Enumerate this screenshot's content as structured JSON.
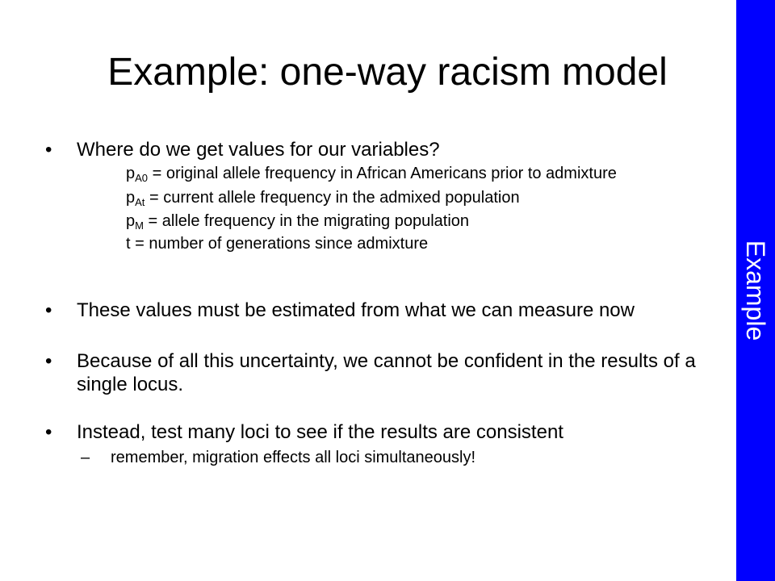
{
  "title": "Example:  one-way racism model",
  "side_label": "Example",
  "colors": {
    "side_bar": "#0000ff",
    "side_text": "#ffffff",
    "text": "#000000"
  },
  "bullets": [
    {
      "marker": "•",
      "text": "Where do we get values for our variables?"
    },
    {
      "marker": "•",
      "text": "These values must be estimated from what we can measure now"
    },
    {
      "marker": "•",
      "text": "Because of all this uncertainty, we cannot be confident in the results of a single locus."
    },
    {
      "marker": "•",
      "text": "Instead, test many loci to see if the results are consistent"
    }
  ],
  "definitions": [
    {
      "var": "p",
      "sub": "A0",
      "text": " = original allele frequency in African Americans prior to admixture"
    },
    {
      "var": "p",
      "sub": "At",
      "text": " = current allele frequency in the admixed population"
    },
    {
      "var": "p",
      "sub": "M",
      "text": " = allele frequency in the migrating population"
    },
    {
      "var": "t",
      "sub": "",
      "text": " = number of generations since admixture"
    }
  ],
  "sub_bullet": {
    "marker": "–",
    "text": "remember, migration effects all loci simultaneously!"
  }
}
